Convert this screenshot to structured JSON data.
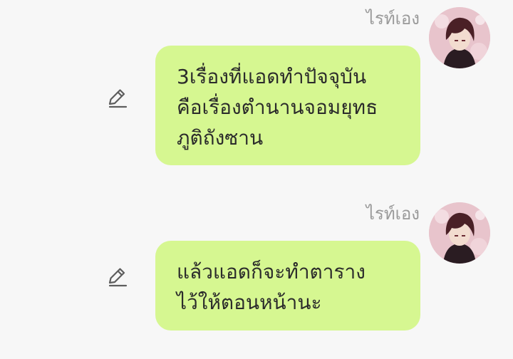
{
  "messages": [
    {
      "sender": "ไรท์เอง",
      "lines": [
        "3เรื่องที่แอดทำปัจจุบัน",
        "คือเรื่องตำนานจอมยุทธ",
        "ภูติถังซาน"
      ],
      "edit_icon": "pencil-icon",
      "avatar": "avatar-image"
    },
    {
      "sender": "ไรท์เอง",
      "lines": [
        "แล้วแอดก็จะทำตาราง",
        "ไว้ให้ตอนหน้านะ"
      ],
      "edit_icon": "pencil-icon",
      "avatar": "avatar-image"
    }
  ],
  "colors": {
    "background": "#f7f7f7",
    "bubble": "#d6f791",
    "sender_text": "#9a9a9a",
    "message_text": "#2b2b2b"
  }
}
